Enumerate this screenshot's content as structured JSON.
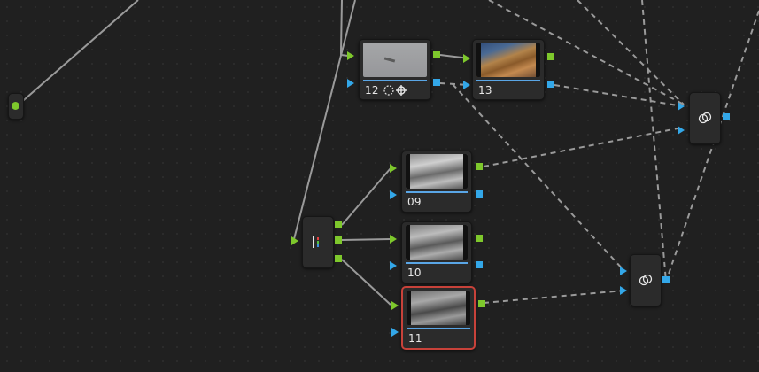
{
  "nodes": {
    "n12": {
      "label": "12"
    },
    "n13": {
      "label": "13"
    },
    "n09": {
      "label": "09"
    },
    "n10": {
      "label": "10"
    },
    "n11": {
      "label": "11"
    }
  },
  "icons": {
    "splitter": "channel-splitter-icon",
    "combiner": "layer-mixer-icon",
    "tracker": "tracker-icon",
    "window": "window-icon"
  },
  "colors": {
    "rgb_port": "#7ec82c",
    "alpha_port": "#33a7e8",
    "selected": "#c8423a"
  }
}
